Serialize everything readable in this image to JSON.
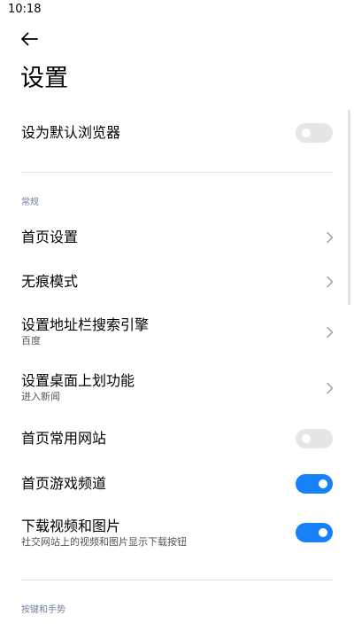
{
  "status_bar": {
    "time": "10:18"
  },
  "header": {
    "title": "设置"
  },
  "default_browser": {
    "label": "设为默认浏览器",
    "enabled": false
  },
  "sections": {
    "general": {
      "label": "常规",
      "items": [
        {
          "title": "首页设置",
          "control": "chevron"
        },
        {
          "title": "无痕模式",
          "control": "chevron"
        },
        {
          "title": "设置地址栏搜索引擎",
          "subtitle": "百度",
          "control": "chevron"
        },
        {
          "title": "设置桌面上划功能",
          "subtitle": "进入新闻",
          "control": "chevron"
        },
        {
          "title": "首页常用网站",
          "control": "toggle",
          "enabled": false
        },
        {
          "title": "首页游戏频道",
          "control": "toggle",
          "enabled": true
        },
        {
          "title": "下载视频和图片",
          "subtitle": "社交网站上的视频和图片显示下载按钮",
          "control": "toggle",
          "enabled": true
        }
      ]
    },
    "keys_gestures": {
      "label": "按键和手势"
    }
  },
  "colors": {
    "toggle_on": "#1681f8",
    "toggle_off": "#e6e6e6",
    "section_label": "#6f7f9a"
  },
  "icons": {
    "back": "arrow-left-icon",
    "chevron": "chevron-right-icon"
  }
}
